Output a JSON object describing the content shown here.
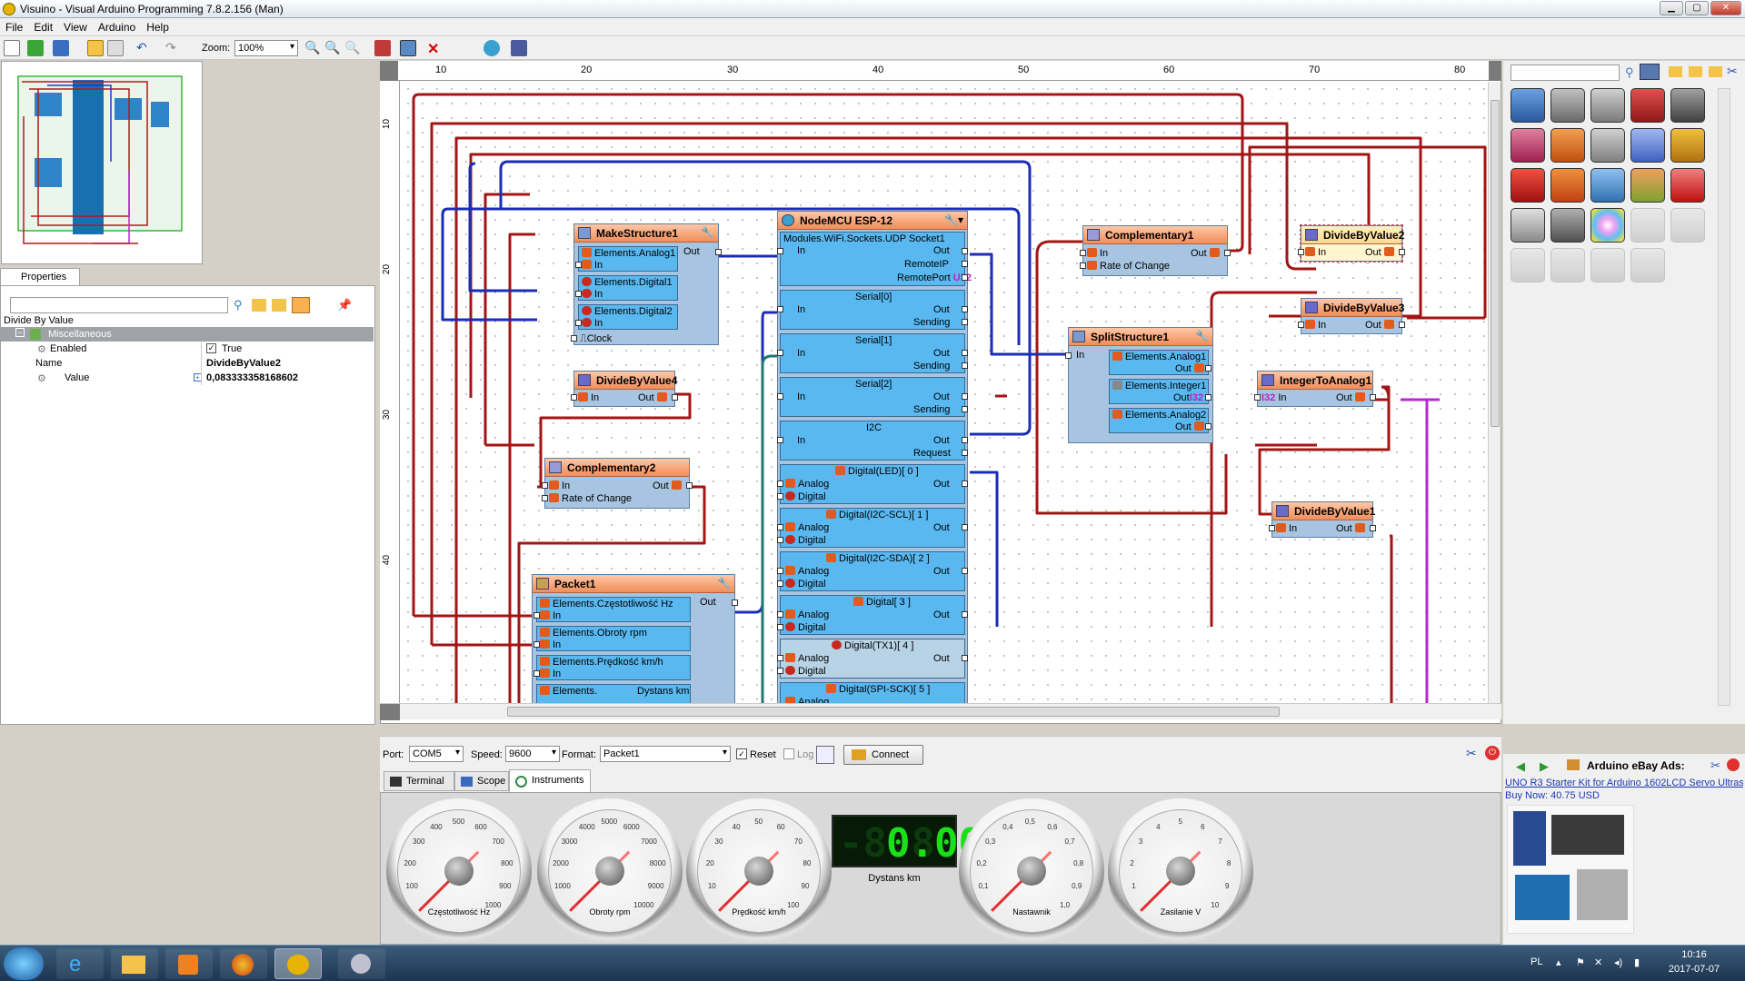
{
  "window": {
    "title": "Visuino - Visual Arduino Programming 7.8.2.156 (Man)",
    "buttons": [
      "▁",
      "▢",
      "✕"
    ]
  },
  "menu": [
    "File",
    "Edit",
    "View",
    "Arduino",
    "Help"
  ],
  "toolbar": {
    "zoom_label": "Zoom:",
    "zoom_value": "100%"
  },
  "properties": {
    "tab_label": "Properties",
    "search_placeholder": "",
    "component_type": "Divide By Value",
    "category": "Miscellaneous",
    "rows": [
      {
        "name": "Enabled",
        "value": "True"
      },
      {
        "name": "Name",
        "value": "DivideByValue2"
      },
      {
        "name": "Value",
        "value": "0,083333358168602"
      }
    ]
  },
  "ruler": {
    "top": [
      "10",
      "20",
      "30",
      "40",
      "50",
      "60",
      "70",
      "80"
    ],
    "left": [
      "10",
      "20",
      "30",
      "40"
    ]
  },
  "components": {
    "make_structure": {
      "title": "MakeStructure1",
      "out": "Out",
      "elements": [
        "Elements.Analog1",
        "Elements.Digital1",
        "Elements.Digital2"
      ],
      "in": "In",
      "clock": "Clock"
    },
    "nodemcu": {
      "title": "NodeMCU ESP-12",
      "udp": "Modules.WiFi.Sockets.UDP Socket1",
      "in": "In",
      "out": "Out",
      "remote_ip": "RemoteIP",
      "remote_port": "RemotePort",
      "u32": "U32",
      "serials": [
        "Serial[0]",
        "Serial[1]",
        "Serial[2]"
      ],
      "sending": "Sending",
      "i2c": "I2C",
      "request": "Request",
      "digitals": [
        "Digital(LED)[ 0 ]",
        "Digital(I2C-SCL)[ 1 ]",
        "Digital(I2C-SDA)[ 2 ]",
        "Digital[ 3 ]",
        "Digital(TX1)[ 4 ]",
        "Digital(SPI-SCK)[ 5 ]"
      ],
      "analog": "Analog",
      "digital": "Digital"
    },
    "complementary1": {
      "title": "Complementary1",
      "in": "In",
      "out": "Out",
      "rate": "Rate of Change"
    },
    "complementary2": {
      "title": "Complementary2",
      "in": "In",
      "out": "Out",
      "rate": "Rate of Change"
    },
    "divide2": {
      "title": "DivideByValue2",
      "in": "In",
      "out": "Out"
    },
    "divide3": {
      "title": "DivideByValue3",
      "in": "In",
      "out": "Out"
    },
    "divide4": {
      "title": "DivideByValue4",
      "in": "In",
      "out": "Out"
    },
    "divide1": {
      "title": "DivideByValue1",
      "in": "In",
      "out": "Out"
    },
    "split": {
      "title": "SplitStructure1",
      "in": "In",
      "out": "Out",
      "elements": [
        "Elements.Analog1",
        "Elements.Integer1",
        "Elements.Analog2"
      ],
      "i32": "I32"
    },
    "int_to_analog": {
      "title": "IntegerToAnalog1",
      "in": "In",
      "out": "Out",
      "i32": "I32"
    },
    "packet": {
      "title": "Packet1",
      "out": "Out",
      "in": "In",
      "elements": [
        "Elements.Częstotliwość Hz",
        "Elements.Obroty rpm",
        "Elements.Prędkość km/h",
        "Elements."
      ],
      "extra": "Dystans km"
    }
  },
  "serial": {
    "port_label": "Port:",
    "port_value": "COM5",
    "speed_label": "Speed:",
    "speed_value": "9600",
    "format_label": "Format:",
    "format_value": "Packet1",
    "reset_label": "Reset",
    "log_label": "Log",
    "connect_label": "Connect",
    "tabs": [
      "Terminal",
      "Scope",
      "Instruments"
    ]
  },
  "instruments": {
    "gauges": [
      {
        "label": "Częstotliwość Hz",
        "ticks": [
          "100",
          "200",
          "300",
          "400",
          "500",
          "600",
          "700",
          "800",
          "900",
          "1000"
        ],
        "value": 0.0
      },
      {
        "label": "Obroty rpm",
        "ticks": [
          "1000",
          "2000",
          "3000",
          "4000",
          "5000",
          "6000",
          "7000",
          "8000",
          "9000",
          "10000"
        ],
        "value": 0.0
      },
      {
        "label": "Prędkość km/h",
        "ticks": [
          "10",
          "20",
          "30",
          "40",
          "50",
          "60",
          "70",
          "80",
          "90",
          "100"
        ],
        "value": 0.0
      },
      {
        "label": "Nastawnik",
        "ticks": [
          "0,1",
          "0,2",
          "0,3",
          "0,4",
          "0,5",
          "0,6",
          "0,7",
          "0,8",
          "0,9",
          "1,0"
        ],
        "value": 0.0
      },
      {
        "label": "Zasilanie V",
        "ticks": [
          "1",
          "2",
          "3",
          "4",
          "5",
          "6",
          "7",
          "8",
          "9",
          "10"
        ],
        "value": 0.0
      }
    ],
    "display": {
      "ghost": "-8.8",
      "value": "0.00",
      "label": "Dystans km"
    }
  },
  "ebay": {
    "title": "Arduino eBay Ads:",
    "ad_text": "UNO R3 Starter Kit for Arduino 1602LCD Servo Ultrasonic",
    "price": "Buy Now: 40.75 USD"
  },
  "taskbar": {
    "lang": "PL",
    "time": "10:16",
    "date": "2017-07-07"
  },
  "colors": {
    "wire_red": "#a31515",
    "wire_blue": "#1a2db5",
    "wire_magenta": "#b62ad0",
    "wire_teal": "#1c7a6e",
    "header": "#f08d5a",
    "body": "#a7c4e0"
  }
}
